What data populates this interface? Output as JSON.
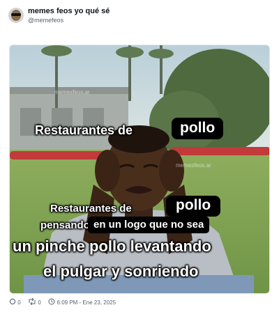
{
  "tweet": {
    "display_name": "memes feos yo qué sé",
    "handle": "@memefeos",
    "timestamp": "6:09 PM - Ene 23, 2025",
    "replies": "0",
    "retweets": "0"
  },
  "meme": {
    "line1_text": "Restaurantes de",
    "line1_box": "pollo",
    "line2_text": "Restaurantes de",
    "line2_box": "pollo",
    "line3_text": "pensando",
    "line3_box": "en un logo que no sea",
    "line4": "un pinche pollo levantando",
    "line5": "el pulgar y sonriendo",
    "watermark1": "memesfeos.ar",
    "watermark2": "memesfeos.ar"
  },
  "icons": {
    "reply": "comment-icon",
    "retweet": "retweet-icon"
  }
}
